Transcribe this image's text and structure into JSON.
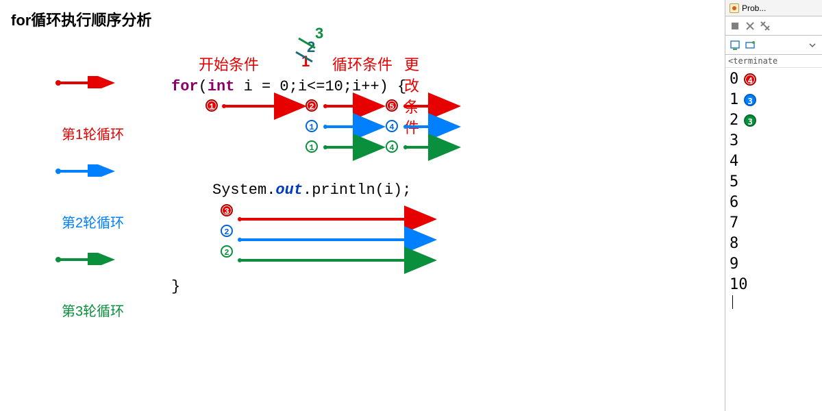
{
  "title": "for循环执行顺序分析",
  "legend": {
    "row1": "第1轮循环",
    "row2": "第2轮循环",
    "row3": "第3轮循环"
  },
  "annotations": {
    "start_cond": "开始条件",
    "loop_cond": "循环条件",
    "update_cond": "更改条件",
    "stack_top": "3",
    "stack_mid": "2",
    "stack_bot": "1"
  },
  "code": {
    "kw_for": "for",
    "lparen": "(",
    "kw_int": "int",
    "ivar": " i = 0;i<=10;i++) {",
    "println_line": "System.",
    "out": "out",
    "println_tail": ".println(i);",
    "rbrace": "}"
  },
  "for_badges": {
    "red1": "1",
    "red2": "2",
    "red5": "5",
    "blue1": "1",
    "blue4": "4",
    "green1": "1",
    "green4": "4"
  },
  "print_badges": {
    "red3": "3",
    "blue2": "2",
    "green2": "2"
  },
  "console": {
    "tab": "Prob...",
    "terminate": "<terminate",
    "outputs": [
      "0",
      "1",
      "2",
      "3",
      "4",
      "5",
      "6",
      "7",
      "8",
      "9",
      "10"
    ],
    "out_badges": {
      "b0": "4",
      "b1": "3",
      "b2": "3"
    }
  },
  "colors": {
    "red": "#e60000",
    "blue": "#0080ff",
    "green": "#0a8f3c",
    "slate": "#1c6b7a"
  }
}
